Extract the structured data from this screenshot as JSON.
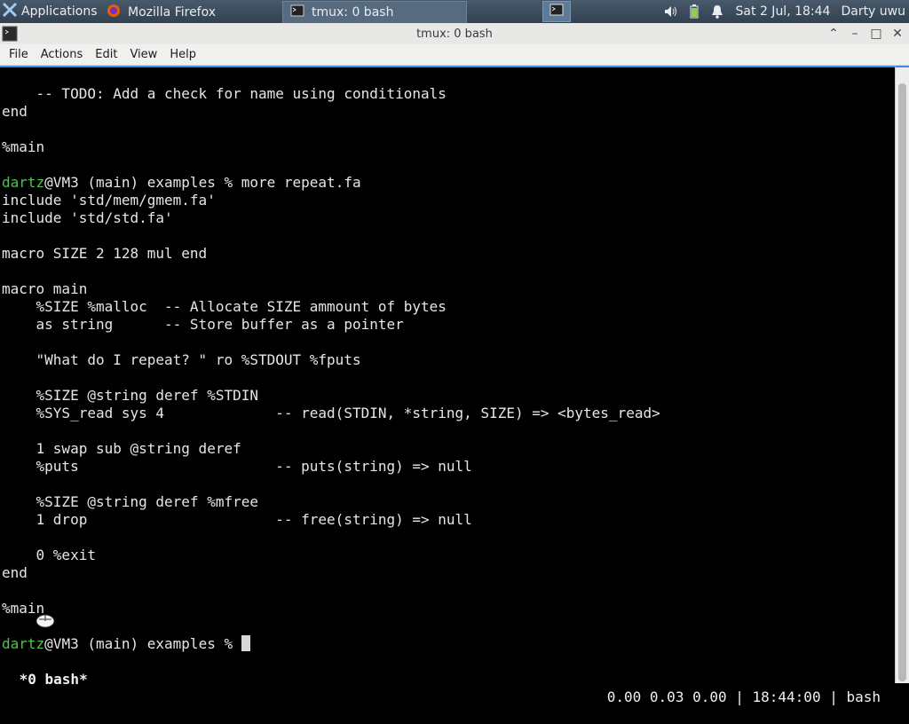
{
  "panel": {
    "apps_label": "Applications",
    "tasks": [
      {
        "label": "Mozilla Firefox",
        "icon": "firefox-icon"
      },
      {
        "label": "tmux: 0 bash",
        "icon": "terminal-icon"
      }
    ],
    "clock": "Sat  2 Jul, 18:44",
    "user": "Darty uwu"
  },
  "window": {
    "title": "tmux: 0 bash"
  },
  "menu": {
    "items": [
      "File",
      "Actions",
      "Edit",
      "View",
      "Help"
    ]
  },
  "terminal": {
    "lines": [
      {
        "text": "    -- TODO: Add a check for name using conditionals"
      },
      {
        "text": "end"
      },
      {
        "text": ""
      },
      {
        "text": "%main"
      },
      {
        "text": ""
      },
      {
        "user": "dartz",
        "text": "@VM3 (main) examples % more repeat.fa"
      },
      {
        "text": "include 'std/mem/gmem.fa'"
      },
      {
        "text": "include 'std/std.fa'"
      },
      {
        "text": ""
      },
      {
        "text": "macro SIZE 2 128 mul end"
      },
      {
        "text": ""
      },
      {
        "text": "macro main"
      },
      {
        "text": "    %SIZE %malloc  -- Allocate SIZE ammount of bytes"
      },
      {
        "text": "    as string      -- Store buffer as a pointer"
      },
      {
        "text": ""
      },
      {
        "text": "    \"What do I repeat? \" ro %STDOUT %fputs"
      },
      {
        "text": ""
      },
      {
        "text": "    %SIZE @string deref %STDIN"
      },
      {
        "text": "    %SYS_read sys 4             -- read(STDIN, *string, SIZE) => <bytes_read>"
      },
      {
        "text": ""
      },
      {
        "text": "    1 swap sub @string deref"
      },
      {
        "text": "    %puts                       -- puts(string) => null"
      },
      {
        "text": ""
      },
      {
        "text": "    %SIZE @string deref %mfree"
      },
      {
        "text": "    1 drop                      -- free(string) => null"
      },
      {
        "text": ""
      },
      {
        "text": "    0 %exit"
      },
      {
        "text": "end"
      },
      {
        "text": ""
      },
      {
        "text": "%main"
      },
      {
        "text": ""
      },
      {
        "user": "dartz",
        "text": "@VM3 (main) examples % ",
        "cursor": true
      }
    ],
    "status_left": " *0 bash*",
    "status_right": "0.00 0.03 0.00 | 18:44:00 | bash"
  },
  "colors": {
    "prompt_user": "#4fc24f",
    "panel_bg": "#3b4a5a",
    "terminal_bg": "#000000",
    "text": "#e6e6e6"
  }
}
